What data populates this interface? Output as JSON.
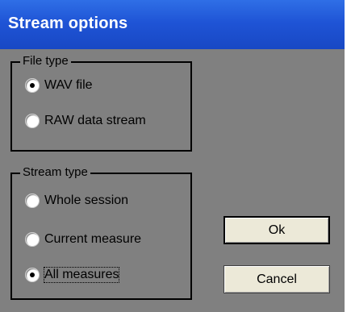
{
  "window": {
    "title": "Stream options"
  },
  "file_type": {
    "legend": "File type",
    "options": [
      {
        "label": "WAV file",
        "checked": true
      },
      {
        "label": "RAW data stream",
        "checked": false
      }
    ]
  },
  "stream_type": {
    "legend": "Stream type",
    "options": [
      {
        "label": "Whole session",
        "checked": false
      },
      {
        "label": "Current measure",
        "checked": false
      },
      {
        "label": "All measures",
        "checked": true
      }
    ]
  },
  "buttons": {
    "ok_label": "Ok",
    "cancel_label": "Cancel"
  }
}
